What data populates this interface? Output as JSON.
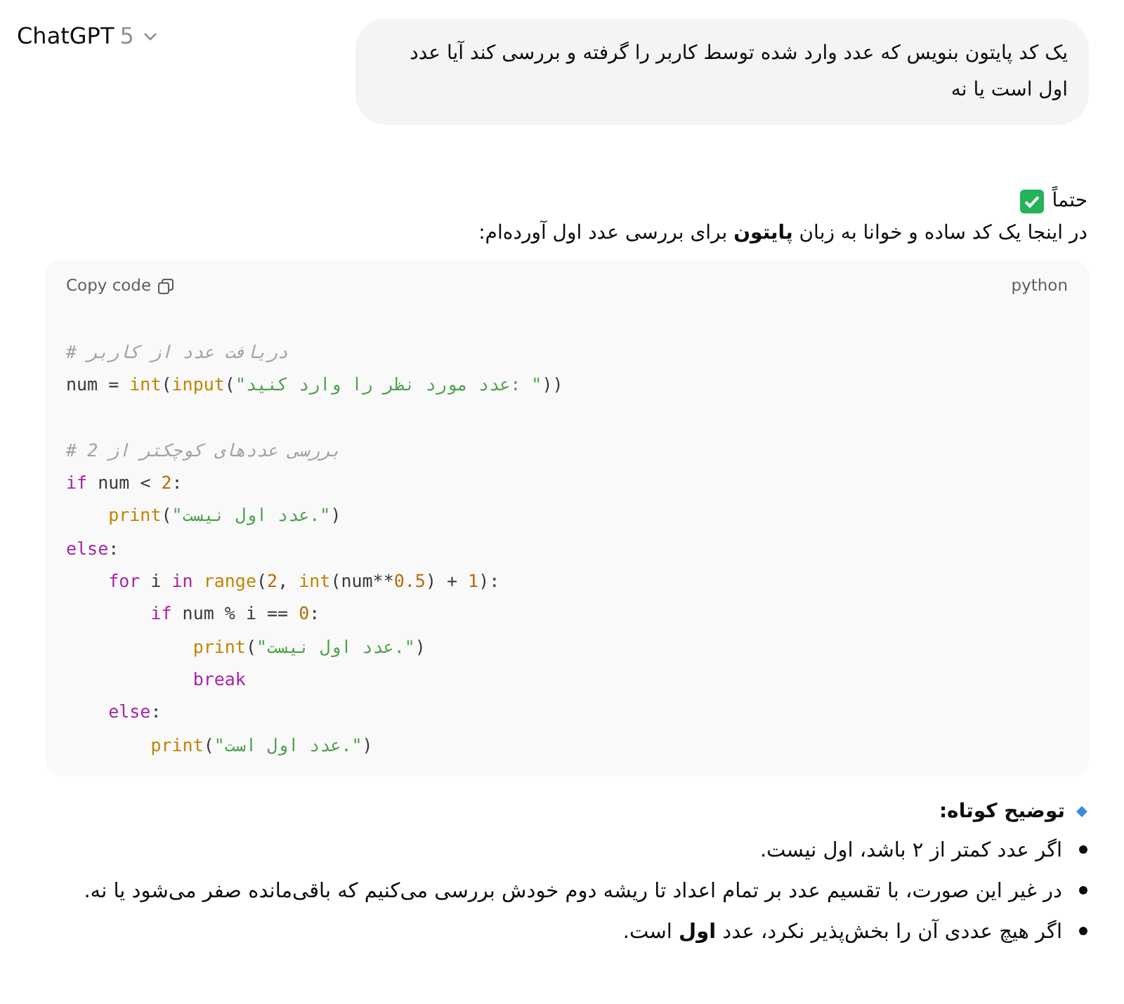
{
  "header": {
    "title": "ChatGPT",
    "version": "5"
  },
  "user_message": "یک کد پایتون بنویس که عدد وارد شده توسط کاربر را گرفته و بررسی کند آیا عدد اول است یا نه",
  "reply": {
    "opening": "حتماً",
    "intro": "در اینجا یک کد ساده و خوانا به زبان **پایتون** برای بررسی عدد اول آورده‌ام:",
    "code_block": {
      "copy_label": "Copy code",
      "language": "python",
      "lines": [
        {
          "kind": "code",
          "text": "# دریافت عدد از کاربر"
        },
        {
          "kind": "code",
          "text": "num = int(input(\"عدد مورد نظر را وارد کنید: \"))"
        },
        {
          "kind": "blank"
        },
        {
          "kind": "code",
          "text": "# بررسی عددهای کوچکتر از 2"
        },
        {
          "kind": "code",
          "text": "if num < 2:"
        },
        {
          "kind": "code",
          "text": "    print(\"عدد اول نیست.\")"
        },
        {
          "kind": "code",
          "text": "else:"
        },
        {
          "kind": "code",
          "text": "    for i in range(2, int(num**0.5) + 1):"
        },
        {
          "kind": "code",
          "text": "        if num % i == 0:"
        },
        {
          "kind": "code",
          "text": "            print(\"عدد اول نیست.\")"
        },
        {
          "kind": "code",
          "text": "            break"
        },
        {
          "kind": "code",
          "text": "    else:"
        },
        {
          "kind": "code",
          "text": "        print(\"عدد اول است.\")"
        }
      ]
    },
    "explanation": {
      "heading": "توضیح کوتاه:",
      "items": [
        "اگر عدد کمتر از ۲ باشد، اول نیست.",
        "در غیر این صورت، با تقسیم عدد بر تمام اعداد تا ریشه دوم خودش بررسی می‌کنیم که باقی‌مانده صفر می‌شود یا نه.",
        "اگر هیچ عددی آن را بخش‌پذیر نکرد، عدد **اول** است."
      ]
    }
  }
}
